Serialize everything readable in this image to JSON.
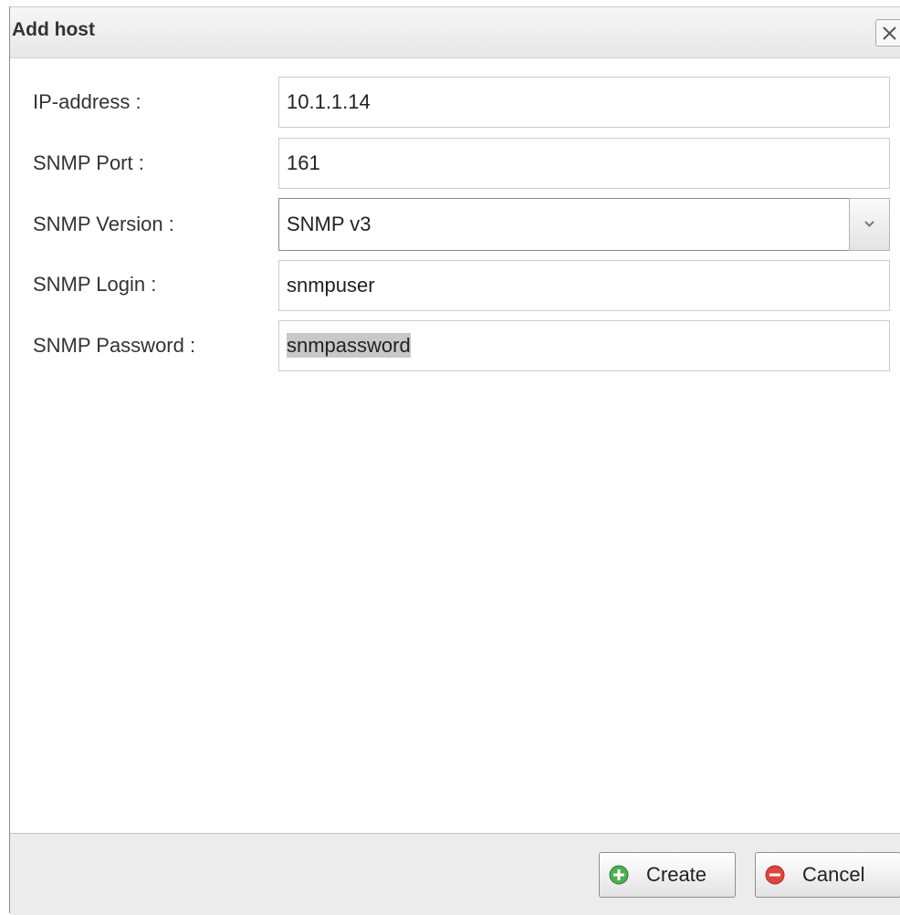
{
  "dialog": {
    "title": "Add host",
    "close_icon": "close-icon"
  },
  "form": {
    "ip_address": {
      "label": "IP-address :",
      "value": "10.1.1.14"
    },
    "snmp_port": {
      "label": "SNMP Port :",
      "value": "161"
    },
    "snmp_version": {
      "label": "SNMP Version :",
      "value": "SNMP v3",
      "arrow_icon": "chevron-down-icon"
    },
    "snmp_login": {
      "label": "SNMP Login :",
      "value": "snmpuser"
    },
    "snmp_password": {
      "label": "SNMP Password :",
      "value": "snmpassword"
    }
  },
  "footer": {
    "create_label": "Create",
    "create_icon": "plus-circle-icon",
    "create_icon_color": "#4caf50",
    "cancel_label": "Cancel",
    "cancel_icon": "minus-circle-icon",
    "cancel_icon_color": "#e0443e"
  }
}
